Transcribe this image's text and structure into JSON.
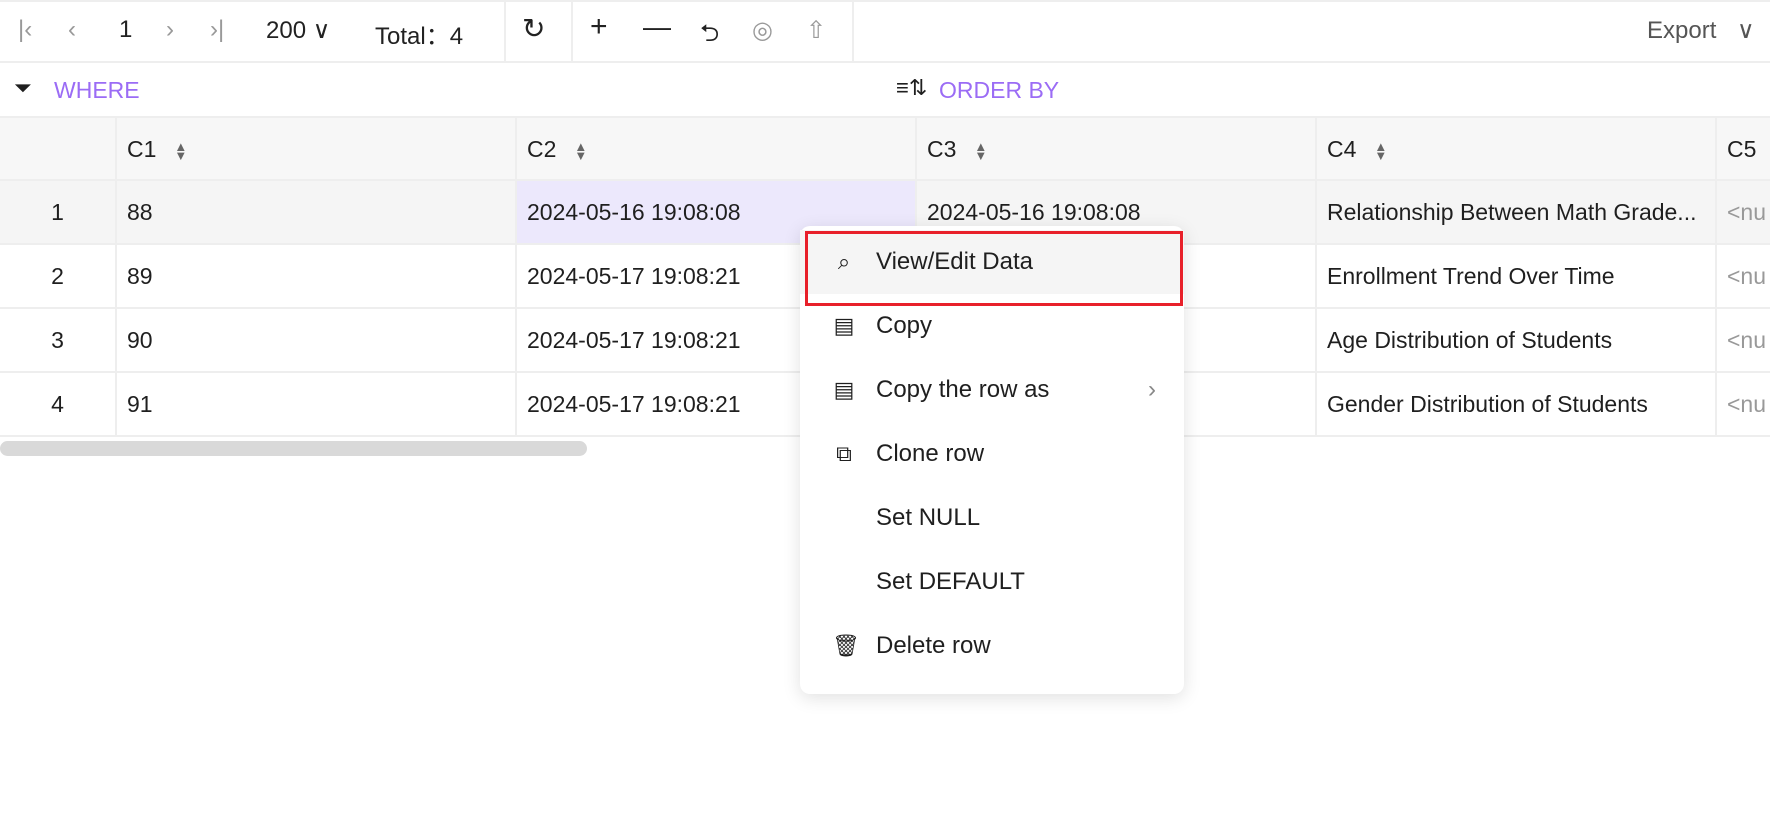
{
  "toolbar": {
    "page": "1",
    "page_size": "200",
    "total_label": "Total：",
    "total": "4",
    "export": "Export"
  },
  "filter": {
    "where": "WHERE",
    "order_by": "ORDER BY"
  },
  "columns": [
    "",
    "C1",
    "C2",
    "C3",
    "C4",
    "C5"
  ],
  "rows": [
    [
      "1",
      "88",
      "2024-05-16 19:08:08",
      "2024-05-16 19:08:08",
      "Relationship Between Math Grade...",
      "<nu"
    ],
    [
      "2",
      "89",
      "2024-05-17 19:08:21",
      "",
      "Enrollment Trend Over Time",
      "<nu"
    ],
    [
      "3",
      "90",
      "2024-05-17 19:08:21",
      "",
      "Age Distribution of Students",
      "<nu"
    ],
    [
      "4",
      "91",
      "2024-05-17 19:08:21",
      "",
      "Gender Distribution of Students",
      "<nu"
    ]
  ],
  "menu": {
    "items": [
      "View/Edit Data",
      "Copy",
      "Copy the row as",
      "Clone row",
      "Set NULL",
      "Set DEFAULT",
      "Delete row"
    ]
  },
  "colors": {
    "accent": "#9b6cf5",
    "highlight": "#ece8fc",
    "annotation": "#e8202a"
  }
}
